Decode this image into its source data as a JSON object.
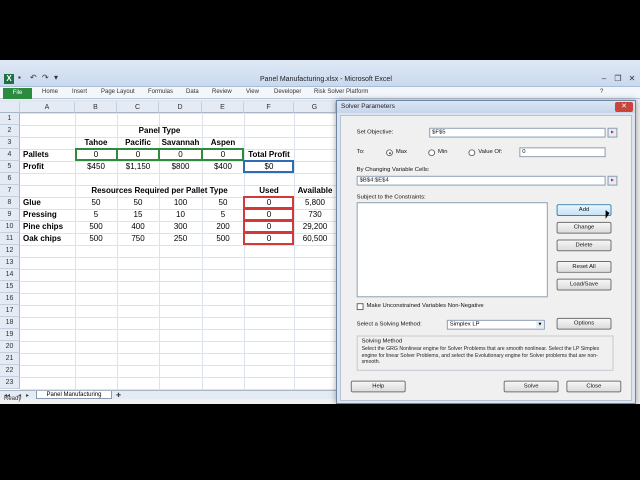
{
  "excel": {
    "title": "Panel Manufacturing.xlsx - Microsoft Excel",
    "file_tab": "File",
    "ribbon_tabs": [
      "Home",
      "Insert",
      "Page Layout",
      "Formulas",
      "Data",
      "Review",
      "View",
      "Developer",
      "Risk Solver Platform"
    ],
    "columns": [
      "A",
      "B",
      "C",
      "D",
      "E",
      "F",
      "G"
    ],
    "rows": [
      "1",
      "2",
      "3",
      "4",
      "5",
      "6",
      "7",
      "8",
      "9",
      "10",
      "11",
      "12",
      "13",
      "14",
      "15",
      "16",
      "17",
      "18",
      "19",
      "20",
      "21",
      "22",
      "23"
    ],
    "sheet_tab": "Panel Manufacturing",
    "status": "Ready"
  },
  "sheet": {
    "panel_type_header": "Panel Type",
    "types": [
      "Tahoe",
      "Pacific",
      "Savannah",
      "Aspen"
    ],
    "total_profit_label": "Total Profit",
    "pallets_label": "Pallets",
    "pallets": [
      "0",
      "0",
      "0",
      "0"
    ],
    "profit_label": "Profit",
    "profits": [
      "$450",
      "$1,150",
      "$800",
      "$400"
    ],
    "total_profit_value": "$0",
    "resources_header": "Resources Required per Pallet Type",
    "used_header": "Used",
    "available_header": "Available",
    "resources": [
      {
        "name": "Glue",
        "req": [
          "50",
          "50",
          "100",
          "50"
        ],
        "used": "0",
        "available": "5,800"
      },
      {
        "name": "Pressing",
        "req": [
          "5",
          "15",
          "10",
          "5"
        ],
        "used": "0",
        "available": "730"
      },
      {
        "name": "Pine chips",
        "req": [
          "500",
          "400",
          "300",
          "200"
        ],
        "used": "0",
        "available": "29,200"
      },
      {
        "name": "Oak chips",
        "req": [
          "500",
          "750",
          "250",
          "500"
        ],
        "used": "0",
        "available": "60,500"
      }
    ]
  },
  "solver": {
    "title": "Solver Parameters",
    "set_objective_label": "Set Objective:",
    "objective_value": "$F$5",
    "to_label": "To:",
    "max_label": "Max",
    "min_label": "Min",
    "value_of_label": "Value Of:",
    "value_of_value": "0",
    "changing_cells_label": "By Changing Variable Cells:",
    "changing_cells_value": "$B$4:$E$4",
    "constraints_label": "Subject to the Constraints:",
    "buttons": {
      "add": "Add",
      "change": "Change",
      "delete": "Delete",
      "reset_all": "Reset All",
      "load_save": "Load/Save",
      "options": "Options",
      "help": "Help",
      "solve": "Solve",
      "close": "Close"
    },
    "nonneg_label": "Make Unconstrained Variables Non-Negative",
    "method_label": "Select a Solving Method:",
    "method_value": "Simplex LP",
    "method_group_title": "Solving Method",
    "method_description": "Select the GRG Nonlinear engine for Solver Problems that are smooth nonlinear. Select the LP Simplex engine for linear Solver Problems, and select the Evolutionary engine for Solver problems that are non-smooth."
  }
}
